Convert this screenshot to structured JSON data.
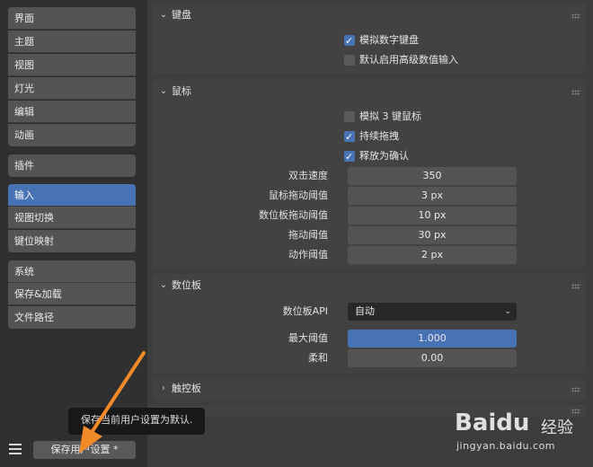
{
  "sidebar": {
    "group1": [
      "界面",
      "主题",
      "视图",
      "灯光",
      "编辑",
      "动画"
    ],
    "group2": [
      "插件"
    ],
    "group3": [
      "输入",
      "视图切换",
      "键位映射"
    ],
    "group4": [
      "系统",
      "保存&加载",
      "文件路径"
    ],
    "active": "输入"
  },
  "keyboard": {
    "title": "键盘",
    "emulate_numpad": {
      "label": "模拟数字键盘",
      "checked": true
    },
    "default_adv_input": {
      "label": "默认启用高级数值输入",
      "checked": false
    }
  },
  "mouse": {
    "title": "鼠标",
    "emulate_3btn": {
      "label": "模拟 3 键鼠标",
      "checked": false
    },
    "continuous_grab": {
      "label": "持续拖拽",
      "checked": true
    },
    "release_confirm": {
      "label": "释放为确认",
      "checked": true
    },
    "fields": [
      {
        "label": "双击速度",
        "value": "350"
      },
      {
        "label": "鼠标拖动阈值",
        "value": "3 px"
      },
      {
        "label": "数位板拖动阈值",
        "value": "10 px"
      },
      {
        "label": "拖动阈值",
        "value": "30 px"
      },
      {
        "label": "动作阈值",
        "value": "2 px"
      }
    ]
  },
  "tablet": {
    "title": "数位板",
    "api_label": "数位板API",
    "api_value": "自动",
    "max_threshold_label": "最大阈值",
    "max_threshold_value": "1.000",
    "max_threshold_fraction": 1.0,
    "softness_label": "柔和",
    "softness_value": "0.00",
    "softness_fraction": 0.0
  },
  "touchpad": {
    "title": "触控板"
  },
  "tooltip": "保存当前用户设置为默认.",
  "save_button": "保存用户设置 *",
  "watermark": {
    "brand": "Baidu",
    "jy": "经验",
    "url": "jingyan.baidu.com"
  },
  "colors": {
    "accent": "#4772b3",
    "arrow": "#f28a2a"
  }
}
